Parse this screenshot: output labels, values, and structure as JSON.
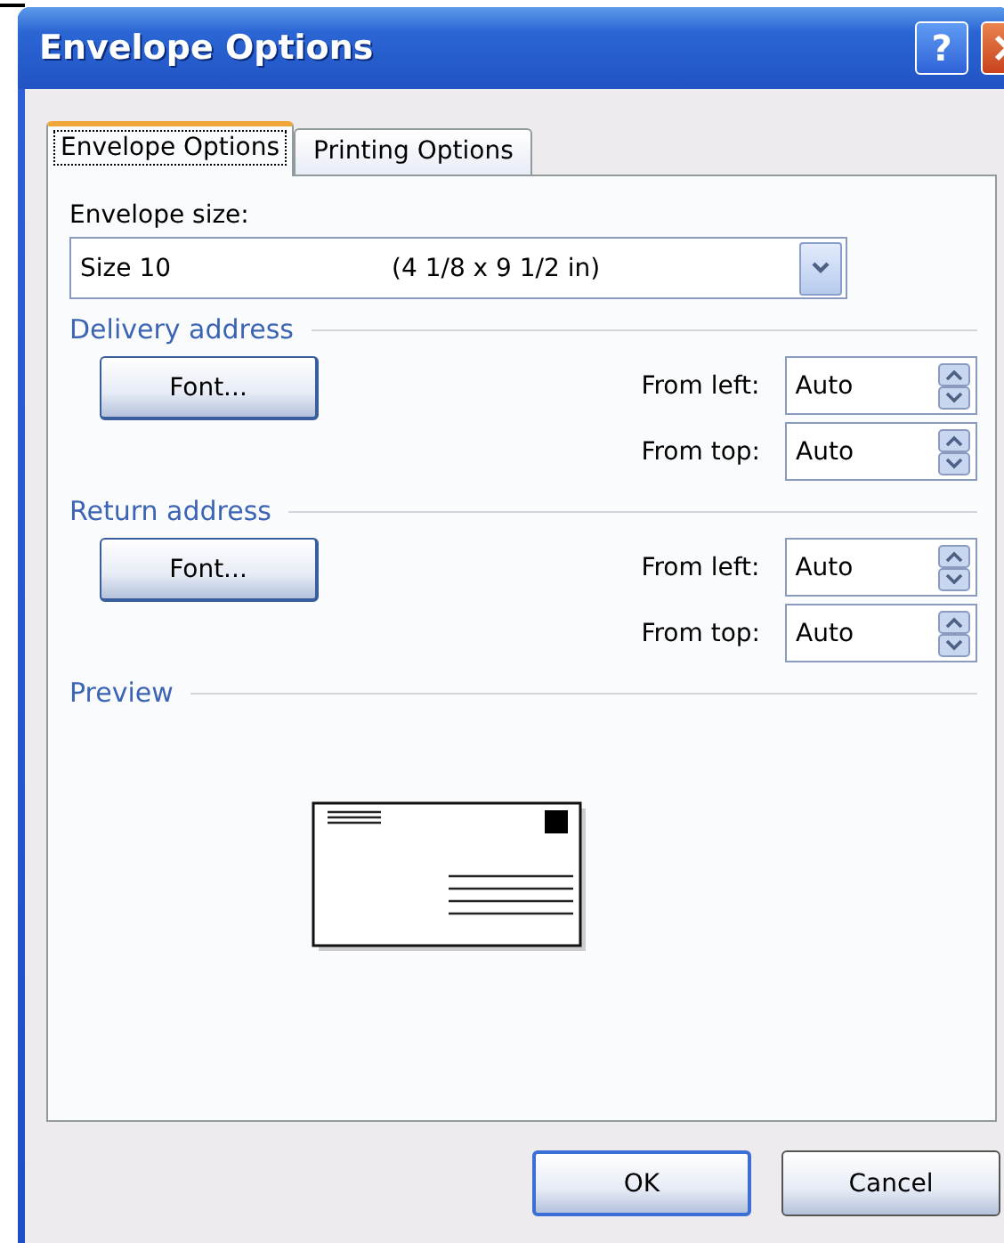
{
  "window": {
    "title": "Envelope Options"
  },
  "title_buttons": [
    {
      "kind": "help",
      "label": "?"
    },
    {
      "kind": "close"
    }
  ],
  "tabs": [
    {
      "label": "Envelope Options",
      "selected": true,
      "focused": true
    },
    {
      "label": "Printing Options",
      "selected": false,
      "focused": false
    }
  ],
  "envelope_size": {
    "label": "Envelope size:",
    "value": "Size 10",
    "dimensions": "(4 1/8 x 9 1/2 in)"
  },
  "sections": [
    {
      "title": "Delivery address",
      "font_button": {
        "label": "Font..."
      },
      "fields": [
        {
          "label": "From left:",
          "value": "Auto"
        },
        {
          "label": "From top:",
          "value": "Auto"
        }
      ]
    },
    {
      "title": "Return address",
      "font_button": {
        "label": "Font..."
      },
      "fields": [
        {
          "label": "From left:",
          "value": "Auto"
        },
        {
          "label": "From top:",
          "value": "Auto"
        }
      ]
    }
  ],
  "preview": {
    "title": "Preview"
  },
  "buttons": [
    {
      "label": "OK",
      "default": true
    },
    {
      "label": "Cancel",
      "default": false
    }
  ]
}
